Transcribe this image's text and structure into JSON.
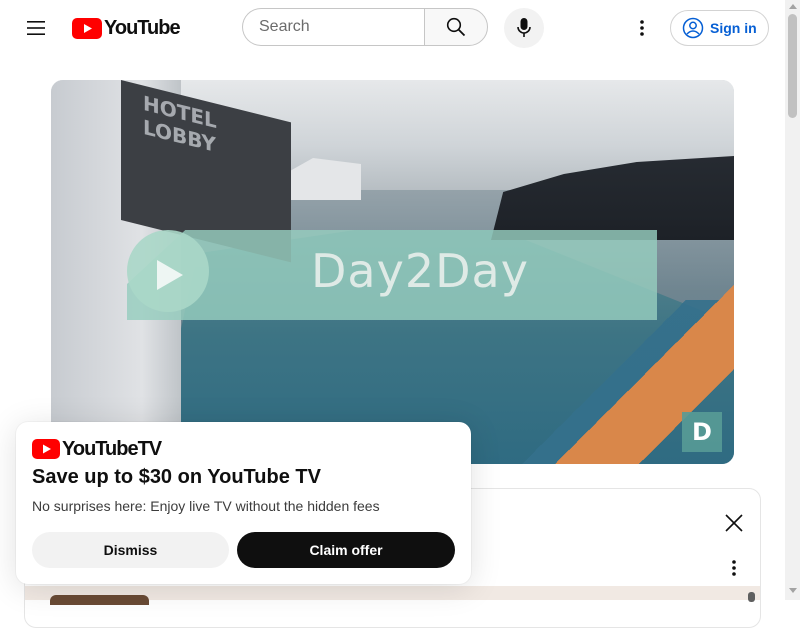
{
  "header": {
    "logo_text": "YouTube",
    "search_placeholder": "Search",
    "signin_label": "Sign in"
  },
  "player": {
    "overlay_sign_line1": "HOTEL",
    "overlay_sign_line2": "LOBBY",
    "banner_text": "Day2Day",
    "badge_letter": "D"
  },
  "promo": {
    "logo_text": "YouTubeTV",
    "title": "Save up to $30 on YouTube TV",
    "subtitle": "No surprises here: Enjoy live TV without the hidden fees",
    "dismiss_label": "Dismiss",
    "claim_label": "Claim offer"
  },
  "colors": {
    "brand_red": "#ff0000",
    "link_blue": "#065fd4",
    "claim_button_bg": "#0f0f0f",
    "dismiss_button_bg": "#f2f2f2"
  },
  "icons": {
    "menu": "hamburger-icon",
    "search": "search-icon",
    "mic": "microphone-icon",
    "more": "more-vertical-icon",
    "account": "account-circle-icon",
    "close": "close-icon"
  }
}
